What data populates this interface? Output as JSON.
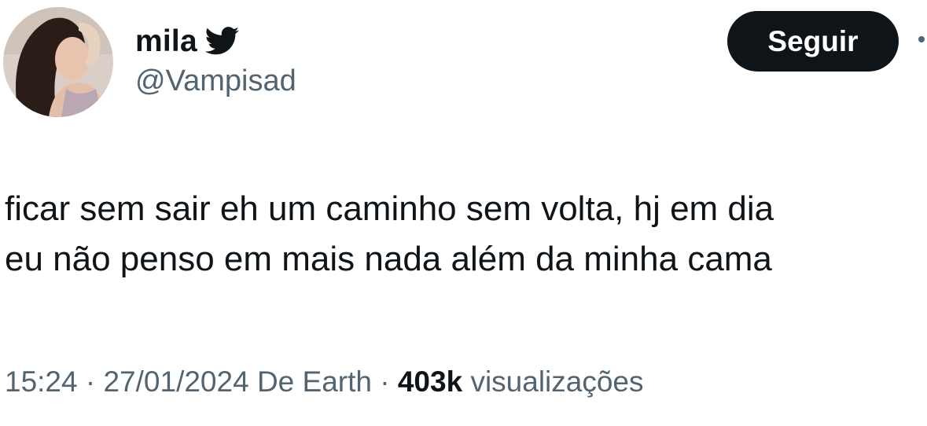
{
  "profile": {
    "display_name": "mila",
    "handle": "@Vampisad",
    "verified_icon": "twitter-bird-icon"
  },
  "actions": {
    "follow_label": "Seguir"
  },
  "tweet": {
    "lines": [
      "ficar sem sair eh um caminho sem volta, hj em dia",
      "eu não penso em mais nada além da minha cama"
    ]
  },
  "meta": {
    "time": "15:24",
    "separator": "·",
    "date": "27/01/2024",
    "source": "De Earth",
    "views_count": "403k",
    "views_label": "visualizações"
  },
  "colors": {
    "text_primary": "#0f1419",
    "text_secondary": "#536471",
    "button_bg": "#0f1419",
    "button_text": "#ffffff"
  }
}
